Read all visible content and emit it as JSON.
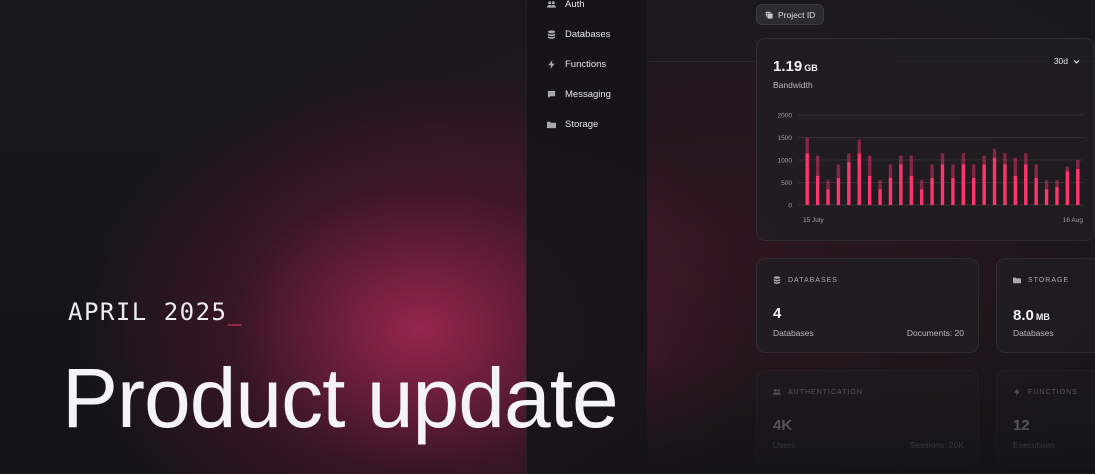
{
  "sidebar": {
    "items": [
      {
        "label": "Auth",
        "icon": "users-icon"
      },
      {
        "label": "Databases",
        "icon": "database-icon"
      },
      {
        "label": "Functions",
        "icon": "bolt-icon"
      },
      {
        "label": "Messaging",
        "icon": "chat-icon"
      },
      {
        "label": "Storage",
        "icon": "folder-icon"
      }
    ]
  },
  "header": {
    "project_id_label": "Project ID"
  },
  "bandwidth": {
    "value": "1.19",
    "unit": "GB",
    "label": "Bandwidth",
    "range": "30d"
  },
  "chart_data": {
    "type": "bar",
    "title": "",
    "xlabel": "",
    "ylabel": "",
    "ylim": [
      0,
      2000
    ],
    "yticks": [
      0,
      500,
      1000,
      1500,
      2000
    ],
    "grid": true,
    "x_tick_labels": [
      "15 July",
      "16 Aug"
    ],
    "bar_color": "#fd366e",
    "series": [
      {
        "values": [
          1150,
          650,
          350,
          600,
          950,
          1150,
          650,
          350,
          600,
          900,
          650,
          350,
          600,
          900,
          600,
          900,
          600,
          900,
          1050,
          900,
          650,
          900,
          600,
          350,
          400,
          750,
          800
        ]
      },
      {
        "values": [
          350,
          450,
          200,
          300,
          200,
          300,
          450,
          200,
          300,
          200,
          450,
          200,
          300,
          250,
          300,
          250,
          300,
          200,
          200,
          250,
          400,
          250,
          300,
          200,
          150,
          100,
          200
        ]
      }
    ]
  },
  "cards": {
    "databases": {
      "title": "DATABASES",
      "value": "4",
      "sub": "Databases",
      "right": "Documents: 20"
    },
    "storage": {
      "title": "STORAGE",
      "value": "8.0",
      "unit": "MB",
      "sub": "Databases"
    },
    "auth": {
      "title": "AUTHENTICATION",
      "value": "4K",
      "sub": "Users",
      "right": "Sessions: 20K"
    },
    "functions": {
      "title": "FUNCTIONS",
      "value": "12",
      "sub": "Executions"
    }
  },
  "hero": {
    "date": "APRIL 2025",
    "cursor": "_",
    "headline": "Product update"
  },
  "colors": {
    "accent": "#fd366e"
  }
}
